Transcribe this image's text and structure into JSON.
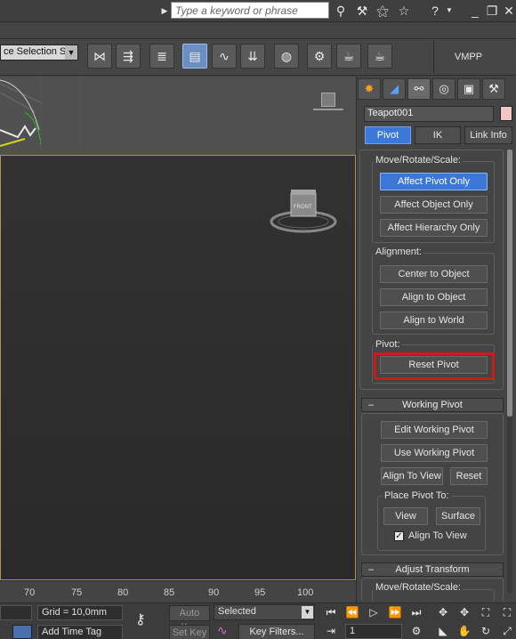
{
  "titlebar": {
    "search_placeholder": "Type a keyword or phrase",
    "icons": [
      "binoculars-icon",
      "wrench-icon",
      "star-search-icon",
      "star-icon",
      "help-icon",
      "minimize-icon",
      "restore-icon",
      "close-icon"
    ]
  },
  "toolbar": {
    "selection_set": "ce Selection Se",
    "vmpp_label": "VMPP",
    "buttons": [
      "mirror-icon",
      "align-icon",
      "layer-icon",
      "scene-explorer-icon",
      "curve-editor-icon",
      "dope-sheet-icon",
      "material-editor-icon",
      "render-setup-icon",
      "render-frame-icon",
      "render-icon"
    ]
  },
  "viewport": {
    "cube_label": "FRONT",
    "accent_color": "#a89a4a"
  },
  "timeline": {
    "ticks": [
      "70",
      "75",
      "80",
      "85",
      "90",
      "95",
      "100"
    ]
  },
  "statusbar": {
    "grid": "Grid = 10,0mm",
    "add_time_tag": "Add Time Tag",
    "auto_key": "Auto Key",
    "set_key": "Set Key",
    "selected": "Selected",
    "key_filters": "Key Filters...",
    "frame": "1"
  },
  "command_panel": {
    "object_name": "Teapot001",
    "object_color": "#f2c6c8",
    "tabs": [
      "create-icon",
      "modify-icon",
      "hierarchy-icon",
      "motion-icon",
      "display-icon",
      "utilities-icon"
    ],
    "sub_tabs": {
      "pivot": "Pivot",
      "ik": "IK",
      "link_info": "Link Info"
    },
    "move_rotate_scale": {
      "title": "Move/Rotate/Scale:",
      "affect_pivot_only": "Affect Pivot Only",
      "affect_object_only": "Affect Object Only",
      "affect_hierarchy_only": "Affect Hierarchy Only"
    },
    "alignment": {
      "title": "Alignment:",
      "center_to_object": "Center to Object",
      "align_to_object": "Align to Object",
      "align_to_world": "Align to World"
    },
    "pivot": {
      "title": "Pivot:",
      "reset_pivot": "Reset Pivot"
    },
    "working_pivot": {
      "header": "Working Pivot",
      "edit_working_pivot": "Edit Working Pivot",
      "use_working_pivot": "Use Working Pivot",
      "align_to_view": "Align To View",
      "reset": "Reset",
      "place_pivot_to": "Place Pivot To:",
      "view": "View",
      "surface": "Surface",
      "align_to_view_checkbox": "Align To View",
      "align_to_view_checked": true
    },
    "adjust_transform": {
      "header": "Adjust Transform",
      "move_rotate_scale": "Move/Rotate/Scale:"
    },
    "highlight_color": "#d01a1a"
  }
}
